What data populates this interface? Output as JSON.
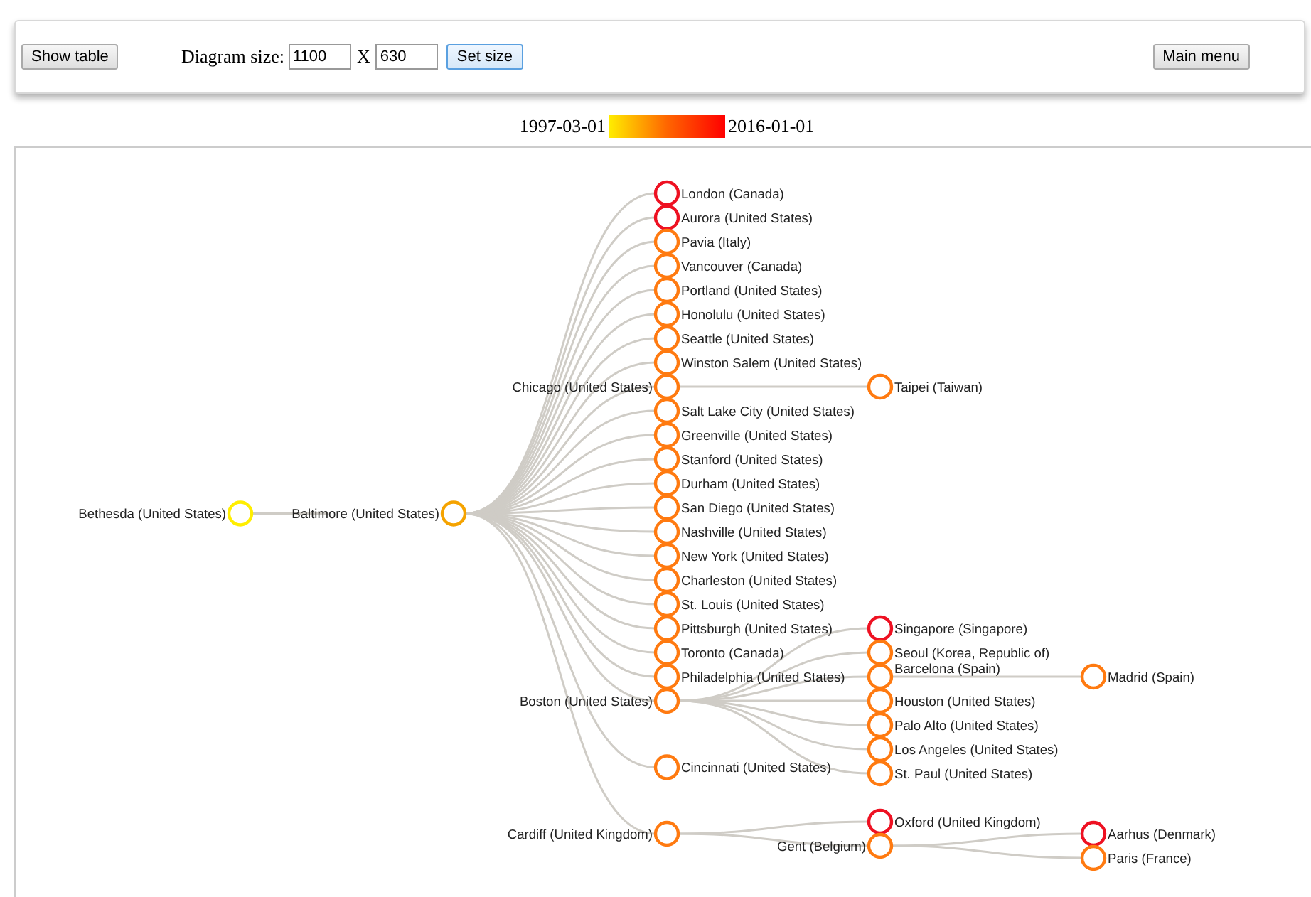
{
  "toolbar": {
    "show_table_button": "Show table",
    "size_label": "Diagram size:",
    "width_value": "1100",
    "separator": "X",
    "height_value": "630",
    "set_size_button": "Set size",
    "main_menu_button": "Main menu"
  },
  "legend": {
    "start_label": "1997-03-01",
    "end_label": "2016-01-01"
  },
  "tree": {
    "label": "Bethesda (United States)",
    "color": "#ffee00",
    "children": [
      {
        "label": "Baltimore (United States)",
        "color": "#f5a300",
        "children": [
          {
            "label": "London (Canada)",
            "color": "#ee1122"
          },
          {
            "label": "Aurora (United States)",
            "color": "#ee1122"
          },
          {
            "label": "Pavia (Italy)",
            "color": "#ff7a10"
          },
          {
            "label": "Vancouver (Canada)",
            "color": "#ff7a10"
          },
          {
            "label": "Portland (United States)",
            "color": "#ff7a10"
          },
          {
            "label": "Honolulu (United States)",
            "color": "#ff7a10"
          },
          {
            "label": "Seattle (United States)",
            "color": "#ff7a10"
          },
          {
            "label": "Winston Salem (United States)",
            "color": "#ff7a10"
          },
          {
            "label": "Chicago (United States)",
            "color": "#ff7a10",
            "children": [
              {
                "label": "Taipei (Taiwan)",
                "color": "#ff7a10"
              }
            ]
          },
          {
            "label": "Salt Lake City (United States)",
            "color": "#ff7a10"
          },
          {
            "label": "Greenville (United States)",
            "color": "#ff7a10"
          },
          {
            "label": "Stanford (United States)",
            "color": "#ff7a10"
          },
          {
            "label": "Durham (United States)",
            "color": "#ff7a10"
          },
          {
            "label": "San Diego (United States)",
            "color": "#ff7a10"
          },
          {
            "label": "Nashville (United States)",
            "color": "#ff7a10"
          },
          {
            "label": "New York (United States)",
            "color": "#ff7a10"
          },
          {
            "label": "Charleston (United States)",
            "color": "#ff7a10"
          },
          {
            "label": "St. Louis (United States)",
            "color": "#ff7a10"
          },
          {
            "label": "Pittsburgh (United States)",
            "color": "#ff7a10"
          },
          {
            "label": "Toronto (Canada)",
            "color": "#ff7a10"
          },
          {
            "label": "Philadelphia (United States)",
            "color": "#ff7a10"
          },
          {
            "label": "Boston (United States)",
            "color": "#ff7a10",
            "children": [
              {
                "label": "Singapore (Singapore)",
                "color": "#ee1122"
              },
              {
                "label": "Seoul (Korea, Republic of)",
                "color": "#ff7a10"
              },
              {
                "label": "Barcelona (Spain)",
                "color": "#ff7a10",
                "children": [
                  {
                    "label": "Madrid (Spain)",
                    "color": "#ff7a10"
                  }
                ]
              },
              {
                "label": "Houston (United States)",
                "color": "#ff7a10"
              },
              {
                "label": "Palo Alto (United States)",
                "color": "#ff7a10"
              },
              {
                "label": "Los Angeles (United States)",
                "color": "#ff7a10"
              },
              {
                "label": "St. Paul (United States)",
                "color": "#ff7a10"
              }
            ]
          },
          {
            "label": "Cincinnati (United States)",
            "color": "#ff7a10"
          },
          {
            "label": "Cardiff (United Kingdom)",
            "color": "#ff7a10",
            "children": [
              {
                "label": "Oxford (United Kingdom)",
                "color": "#ee1122"
              },
              {
                "label": "Gent (Belgium)",
                "color": "#ff7a10",
                "children": [
                  {
                    "label": "Aarhus (Denmark)",
                    "color": "#ee1122"
                  },
                  {
                    "label": "Paris (France)",
                    "color": "#ff7a10"
                  }
                ]
              }
            ]
          }
        ]
      }
    ]
  }
}
